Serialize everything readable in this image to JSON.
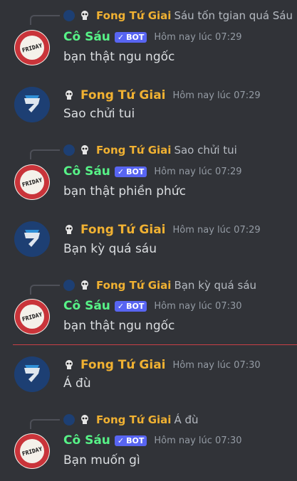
{
  "messages": [
    {
      "author": "Cô Sáu",
      "bot_label": "BOT",
      "time": "Hôm nay lúc 07:29",
      "text": "bạn thật ngu ngốc",
      "reply": {
        "author": "Fong Tứ Giai",
        "text": "Sáu tốn tgian quá Sáu"
      }
    },
    {
      "author": "Fong Tứ Giai",
      "time": "Hôm nay lúc 07:29",
      "text": "Sao chửi tui"
    },
    {
      "author": "Cô Sáu",
      "bot_label": "BOT",
      "time": "Hôm nay lúc 07:29",
      "text": "bạn thật phiền phức",
      "reply": {
        "author": "Fong Tứ Giai",
        "text": "Sao chửi tui"
      }
    },
    {
      "author": "Fong Tứ Giai",
      "time": "Hôm nay lúc 07:29",
      "text": "Bạn kỳ quá sáu"
    },
    {
      "author": "Cô Sáu",
      "bot_label": "BOT",
      "time": "Hôm nay lúc 07:30",
      "text": "bạn thật ngu ngốc",
      "reply": {
        "author": "Fong Tứ Giai",
        "text": "Bạn kỳ quá sáu"
      }
    },
    {
      "author": "Fong Tứ Giai",
      "time": "Hôm nay lúc 07:30",
      "text": "Á đù"
    },
    {
      "author": "Cô Sáu",
      "bot_label": "BOT",
      "time": "Hôm nay lúc 07:30",
      "text": "Bạn muốn gì",
      "reply": {
        "author": "Fong Tứ Giai",
        "text": "Á đù"
      }
    }
  ],
  "icons": {
    "bot_check": "check-icon",
    "skull": "skull-icon"
  },
  "colors": {
    "bot_name": "#57f287",
    "user_name": "#f0b132",
    "bot_badge": "#5865f2",
    "new_divider": "#c94046"
  }
}
